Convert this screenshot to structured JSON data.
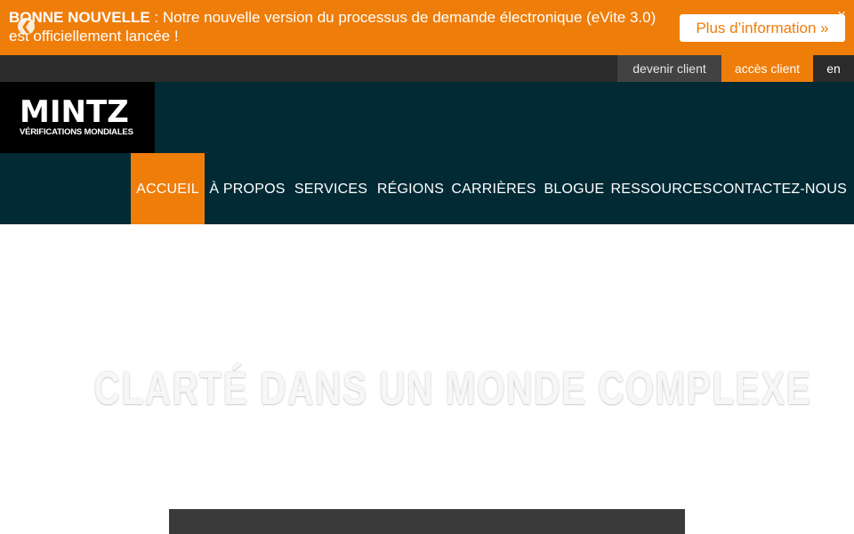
{
  "notice": {
    "bold_label": "BONNE NOUVELLE",
    "text": " : Notre nouvelle version du processus de demande électronique (eVite 3.0) est officiellement lancée !",
    "button_label": "Plus d’information »",
    "close_label": "X",
    "arrow_glyph": "❮"
  },
  "utility": {
    "devenir_client": "devenir client",
    "acces_client": "accès client",
    "lang": "en"
  },
  "logo": {
    "main": "MINTZ",
    "sub": "VÉRIFICATIONS MONDIALES"
  },
  "nav": {
    "items": [
      {
        "label": "ACCUEIL",
        "active": true
      },
      {
        "label": "À PROPOS",
        "active": false
      },
      {
        "label": "SERVICES",
        "active": false
      },
      {
        "label": "RÉGIONS",
        "active": false
      },
      {
        "label": "CARRIÈRES",
        "active": false
      },
      {
        "label": "BLOGUE",
        "active": false
      },
      {
        "label": "RESSOURCES",
        "active": false
      },
      {
        "label": "CONTACTEZ-NOUS",
        "active": false
      }
    ]
  },
  "hero": {
    "title": "CLARTÉ DANS UN MONDE COMPLEXE"
  },
  "colors": {
    "accent": "#ef7d0a",
    "header_bg": "#022a35",
    "utility_bg": "#2b2b2b",
    "logo_bg": "#000000"
  }
}
